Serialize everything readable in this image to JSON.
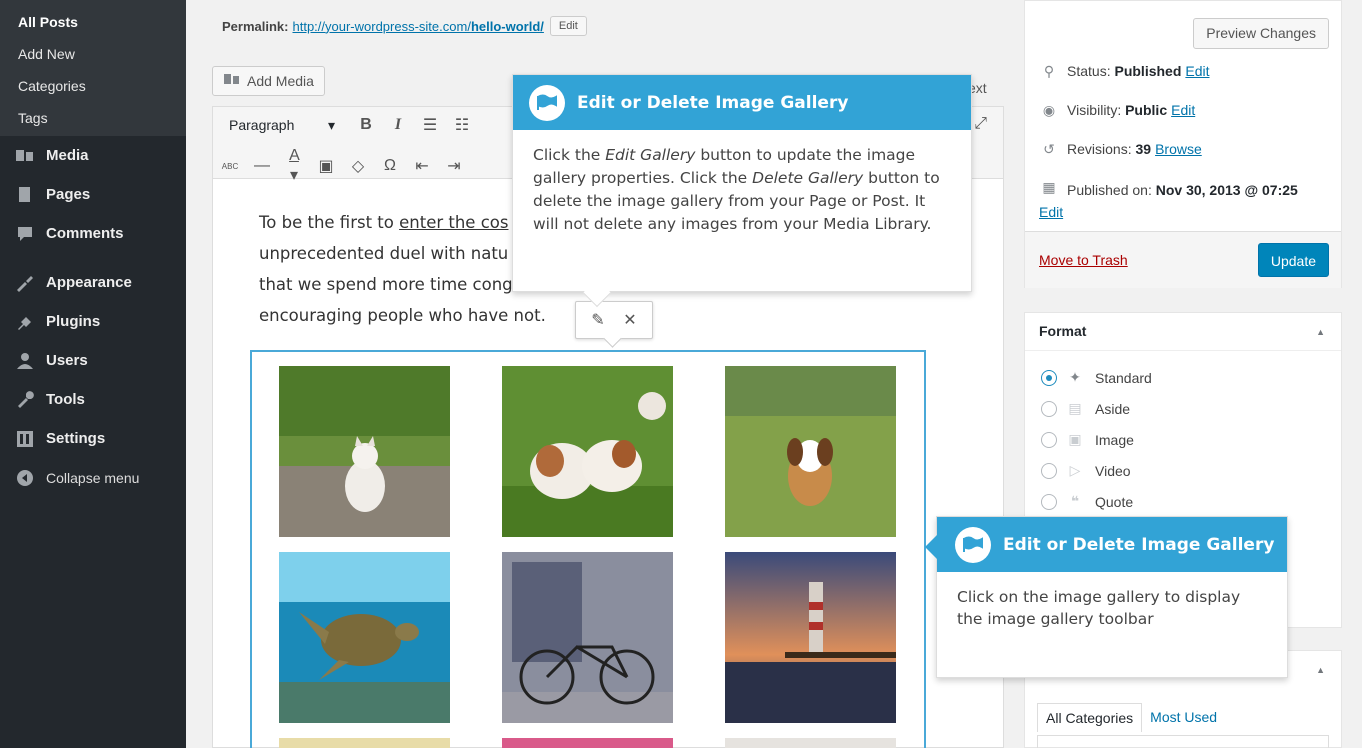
{
  "sidebar": {
    "submenu": [
      "All Posts",
      "Add New",
      "Categories",
      "Tags"
    ],
    "menu": [
      {
        "label": "Media",
        "icon": "media-icon"
      },
      {
        "label": "Pages",
        "icon": "pages-icon"
      },
      {
        "label": "Comments",
        "icon": "comments-icon"
      },
      {
        "label": "Appearance",
        "icon": "appearance-icon"
      },
      {
        "label": "Plugins",
        "icon": "plugins-icon"
      },
      {
        "label": "Users",
        "icon": "users-icon"
      },
      {
        "label": "Tools",
        "icon": "tools-icon"
      },
      {
        "label": "Settings",
        "icon": "settings-icon"
      }
    ],
    "collapse": "Collapse menu"
  },
  "editor": {
    "permalink_label": "Permalink:",
    "permalink_prefix": "http://your-wordpress-site.com/",
    "permalink_slug": "hello-world/",
    "permalink_edit": "Edit",
    "add_media": "Add Media",
    "tab_text": "ext",
    "format_select": "Paragraph",
    "content": {
      "line1_a": "To be the first to ",
      "line1_link": "enter the cos",
      "line2": "unprecedented duel with natu",
      "line3": "that we spend more time cong",
      "line4": "encouraging people who have not."
    }
  },
  "pointer_top": {
    "title": "Edit or Delete Image Gallery",
    "body_1": "Click the ",
    "body_em1": "Edit Gallery",
    "body_2": " button to update the image gallery properties. Click the ",
    "body_em2": "Delete Gallery",
    "body_3": " button to delete the image gallery from your Page or Post. It will not delete any images from your Media Library."
  },
  "pointer_side": {
    "title": "Edit or Delete Image Gallery",
    "body": "Click on the image gallery to display the image gallery toolbar"
  },
  "publish": {
    "preview": "Preview Changes",
    "status_label": "Status:",
    "status_value": "Published",
    "visibility_label": "Visibility:",
    "visibility_value": "Public",
    "revisions_label": "Revisions:",
    "revisions_value": "39",
    "browse": "Browse",
    "published_label": "Published on:",
    "published_value": "Nov 30, 2013 @ 07:25",
    "edit": "Edit",
    "trash": "Move to Trash",
    "update": "Update"
  },
  "format": {
    "title": "Format",
    "options": [
      "Standard",
      "Aside",
      "Image",
      "Video",
      "Quote"
    ],
    "selected": "Standard"
  },
  "categories": {
    "tab_all": "All Categories",
    "tab_used": "Most Used"
  },
  "colors": {
    "accent": "#0073aa",
    "pointer_header": "#32a3d6",
    "sidebar": "#23282d",
    "update_button": "#0085ba"
  }
}
